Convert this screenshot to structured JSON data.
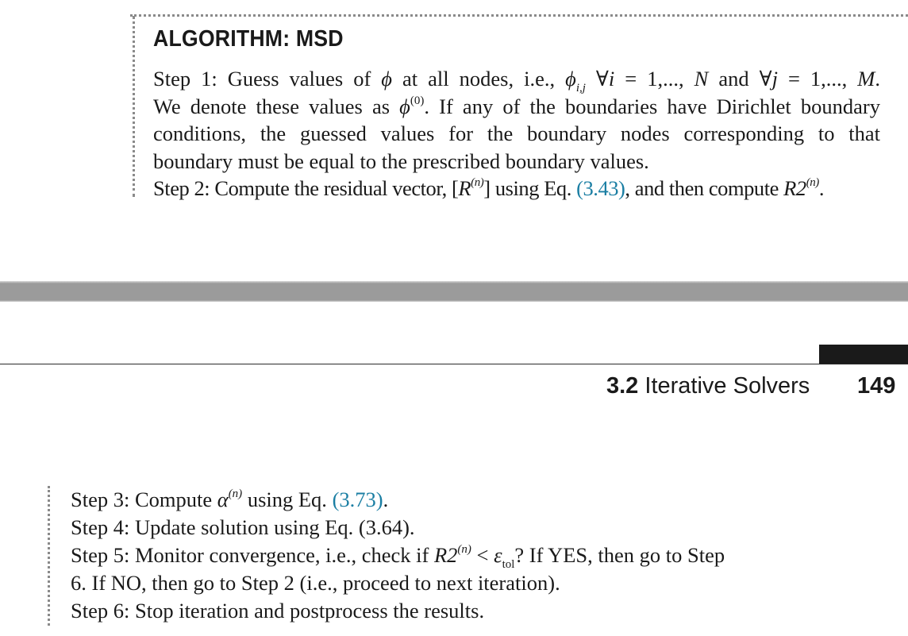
{
  "algorithm": {
    "title": "ALGORITHM: MSD",
    "step1": {
      "a": "Step 1: Guess values of ",
      "phi": "ϕ",
      "b": " at all nodes, i.e., ",
      "phi_ij": "ϕ",
      "sub_ij": "i,j",
      "c": " ∀",
      "i_eq": "i",
      "d": " = 1,..., ",
      "N": "N",
      "e": " and ∀",
      "j_eq": "j",
      "f": " = 1,..., ",
      "M": "M",
      "g": ".",
      "line2a": "We denote these values as ",
      "phi0": "ϕ",
      "sup0": "(0)",
      "line2b": ". If any of the boundaries have Dirichlet boundary",
      "line3": "conditions, the guessed values for the boundary nodes corresponding to that",
      "line4": "boundary must be equal to the prescribed boundary values."
    },
    "step2": {
      "a": "Step 2: Compute the residual vector, [",
      "R": "R",
      "sup_n": "(n)",
      "b": "] using Eq. ",
      "eq_ref": "(3.43)",
      "c": ", and then compute ",
      "R2": "R2",
      "sup_n2": "(n)",
      "d": "."
    },
    "step3": {
      "a": "Step 3: Compute ",
      "alpha": "α",
      "sup_n": "(n)",
      "b": " using Eq. ",
      "eq_ref": "(3.73)",
      "c": "."
    },
    "step4": "Step 4: Update solution using Eq. (3.64).",
    "step5": {
      "a": "Step 5: Monitor convergence, i.e., check if ",
      "R2": "R2",
      "sup_n": "(n)",
      "b": " < ",
      "eps": "ε",
      "sub_tol": "tol",
      "c": "? If YES, then go to Step",
      "line2": "6. If NO, then go to Step 2 (i.e., proceed to next iteration)."
    },
    "step6": "Step 6: Stop iteration and postprocess the results."
  },
  "header": {
    "section_number": "3.2",
    "section_title": " Iterative Solvers",
    "page_number": "149"
  },
  "colors": {
    "link": "#1a7ea3",
    "divider_band": "#9b9b9b",
    "tab": "#1a1a1a"
  }
}
